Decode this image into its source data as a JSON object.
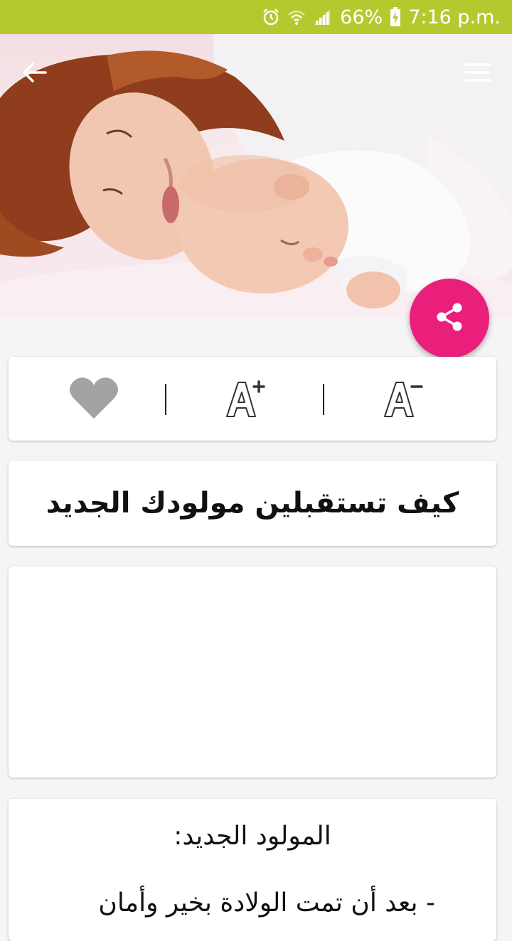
{
  "status_bar": {
    "battery_percent": "66%",
    "time": "7:16 p.m.",
    "icons": [
      "alarm-icon",
      "wifi-icon",
      "signal-icon",
      "battery-charging-icon"
    ],
    "background_color": "#b5c92e"
  },
  "header": {
    "back_icon": "arrow-back-icon",
    "menu_icon": "menu-icon"
  },
  "fab": {
    "icon": "share-icon",
    "color": "#ea1e7b"
  },
  "toolbar": {
    "icons": [
      "heart-icon",
      "font-increase-icon",
      "font-decrease-icon"
    ],
    "heart_color": "#a3a3a3"
  },
  "article": {
    "title": "كيف تستقبلين مولودك الجديد",
    "section_heading": "المولود الجديد:",
    "first_line": "- بعد أن تمت الولادة بخير وأمان"
  }
}
